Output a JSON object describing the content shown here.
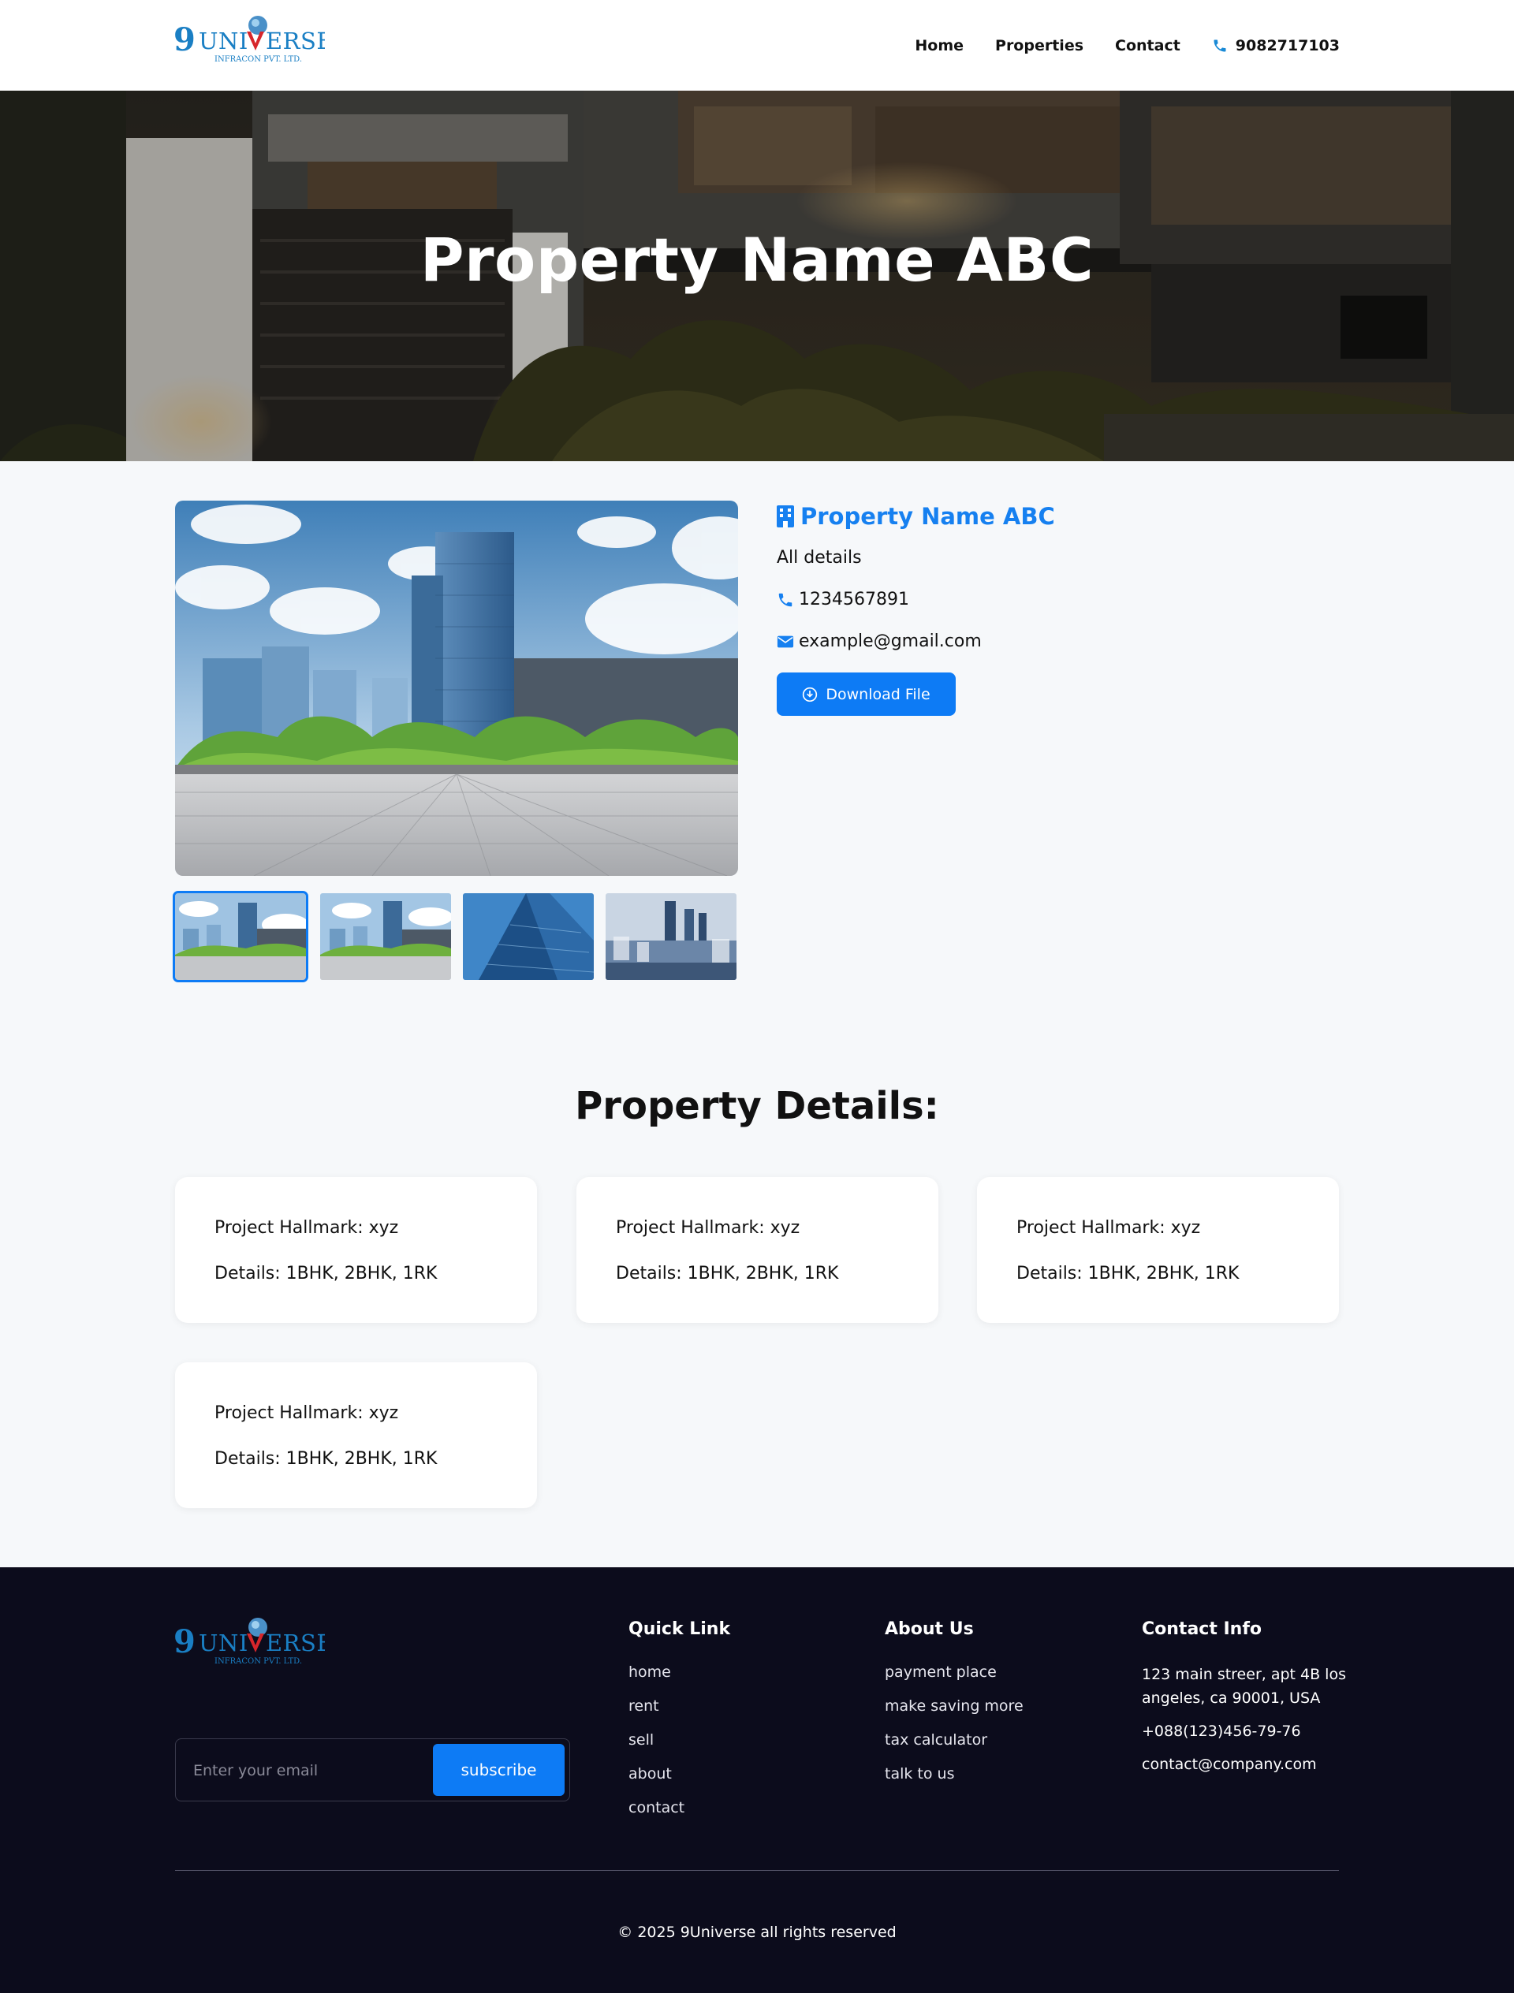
{
  "brand": {
    "logo_number": "9",
    "logo_word": "UNIVERSE",
    "logo_tagline": "INFRACON PVT. LTD."
  },
  "nav": {
    "items": [
      "Home",
      "Properties",
      "Contact"
    ],
    "phone": "9082717103",
    "phone_icon": "phone-icon"
  },
  "hero": {
    "title": "Property Name ABC"
  },
  "property": {
    "title": "Property Name ABC",
    "title_icon": "building-icon",
    "details": "All details",
    "phone": "1234567891",
    "email": "example@gmail.com",
    "download_label": "Download File",
    "download_icon": "download-circle-icon"
  },
  "gallery": {
    "thumbnails": [
      "glass towers with trees",
      "glass towers with trees",
      "blue skyscraper",
      "city skyline"
    ],
    "active_index": 0
  },
  "details_section": {
    "heading": "Property Details:",
    "cards": [
      {
        "hallmark": "Project Hallmark: xyz",
        "details": "Details: 1BHK, 2BHK, 1RK"
      },
      {
        "hallmark": "Project Hallmark: xyz",
        "details": "Details: 1BHK, 2BHK, 1RK"
      },
      {
        "hallmark": "Project Hallmark: xyz",
        "details": "Details: 1BHK, 2BHK, 1RK"
      },
      {
        "hallmark": "Project Hallmark: xyz",
        "details": "Details: 1BHK, 2BHK, 1RK"
      }
    ]
  },
  "footer": {
    "email_placeholder": "Enter your email",
    "subscribe_label": "subscribe",
    "quick_link": {
      "title": "Quick Link",
      "items": [
        "home",
        "rent",
        "sell",
        "about",
        "contact"
      ]
    },
    "about_us": {
      "title": "About Us",
      "items": [
        "payment place",
        "make saving more",
        "tax calculator",
        "talk to us"
      ]
    },
    "contact_info": {
      "title": "Contact Info",
      "address": "123 main streer, apt 4B los angeles, ca 90001, USA",
      "phone": "+088(123)456-79-76",
      "email": "contact@company.com"
    },
    "copyright": "© 2025 9Universe all rights reserved"
  },
  "colors": {
    "accent": "#0d7bf5",
    "title_blue": "#1680f0",
    "footer_bg": "#0c0c1c",
    "page_bg": "#f6f8fa",
    "logo_blue": "#1a7fc4",
    "logo_red": "#d7262b"
  }
}
